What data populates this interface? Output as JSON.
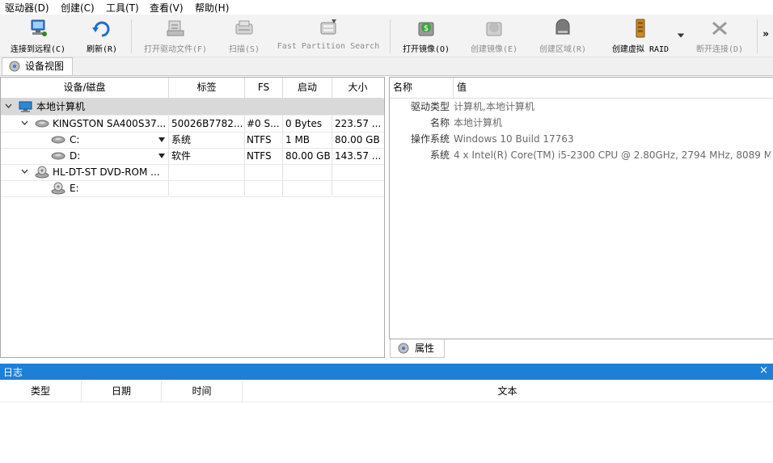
{
  "menu": [
    "驱动器(D)",
    "创建(C)",
    "工具(T)",
    "查看(V)",
    "帮助(H)"
  ],
  "toolbar": {
    "connect": "连接到远程(C)",
    "refresh": "刷新(R)",
    "open_drive_files": "打开驱动文件(F)",
    "scan": "扫描(S)",
    "fast_partition_search": "Fast Partition Search",
    "open_image": "打开镜像(O)",
    "create_image": "创建镜像(E)",
    "create_region": "创建区域(R)",
    "create_virtual_raid": "创建虚拟 RAID",
    "disconnect": "断开连接(D)",
    "more": "»"
  },
  "view_tab": "设备视图",
  "device_table": {
    "headers": [
      "设备/磁盘",
      "标签",
      "FS",
      "启动",
      "大小"
    ],
    "rows": [
      {
        "name": "本地计算机",
        "label": "",
        "fs": "",
        "start": "",
        "size": ""
      },
      {
        "name": "KINGSTON SA400S37...",
        "label": "50026B7782...",
        "fs": "#0 S...",
        "start": "0 Bytes",
        "size": "223.57 ..."
      },
      {
        "name": "C:",
        "label": "系统",
        "fs": "NTFS",
        "start": "1 MB",
        "size": "80.00 GB"
      },
      {
        "name": "D:",
        "label": "软件",
        "fs": "NTFS",
        "start": "80.00 GB",
        "size": "143.57 ..."
      },
      {
        "name": "HL-DT-ST DVD-ROM ...",
        "label": "",
        "fs": "",
        "start": "",
        "size": ""
      },
      {
        "name": "E:",
        "label": "",
        "fs": "",
        "start": "",
        "size": ""
      }
    ]
  },
  "properties": {
    "headers": [
      "名称",
      "值"
    ],
    "rows": [
      {
        "name": "驱动类型",
        "value": "计算机,本地计算机"
      },
      {
        "name": "名称",
        "value": "本地计算机"
      },
      {
        "name": "操作系统",
        "value": "Windows 10 Build 17763"
      },
      {
        "name": "系统",
        "value": "4 x Intel(R) Core(TM) i5-2300 CPU @ 2.80GHz, 2794 MHz, 8089 M..."
      }
    ],
    "tab": "属性"
  },
  "log": {
    "title": "日志",
    "close": "×",
    "columns": [
      "类型",
      "日期",
      "时间",
      "文本"
    ]
  },
  "colors": {
    "log_bar": "#1e7fd6",
    "selected_row": "#d9d9d9",
    "toolbar_bg": "#f3f3f3"
  }
}
